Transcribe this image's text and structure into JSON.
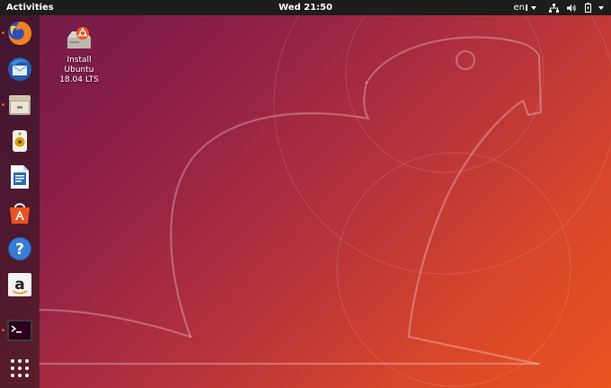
{
  "top_bar": {
    "activities": "Activities",
    "clock": "Wed 21:50",
    "language": "en",
    "network_icon": "network-wired-icon",
    "volume_icon": "volume-icon",
    "power_icon": "battery-icon"
  },
  "dock": {
    "items": [
      {
        "name": "Firefox",
        "icon": "firefox-icon",
        "running": true
      },
      {
        "name": "Thunderbird",
        "icon": "thunderbird-icon",
        "running": false
      },
      {
        "name": "Files",
        "icon": "files-icon",
        "running": true
      },
      {
        "name": "Rhythmbox",
        "icon": "rhythmbox-icon",
        "running": false
      },
      {
        "name": "LibreOffice Writer",
        "icon": "writer-icon",
        "running": false
      },
      {
        "name": "Ubuntu Software",
        "icon": "software-icon",
        "running": false
      },
      {
        "name": "Help",
        "icon": "help-icon",
        "running": false
      },
      {
        "name": "Amazon",
        "icon": "amazon-icon",
        "running": false
      },
      {
        "name": "Terminal",
        "icon": "terminal-icon",
        "running": true
      },
      {
        "name": "Show Applications",
        "icon": "app-grid-icon",
        "running": false
      }
    ]
  },
  "desktop": {
    "icon_label_line1": "Install",
    "icon_label_line2": "Ubuntu",
    "icon_label_line3": "18.04 LTS"
  },
  "colors": {
    "top_bar": "#1d1d1d",
    "accent": "#e95420"
  }
}
